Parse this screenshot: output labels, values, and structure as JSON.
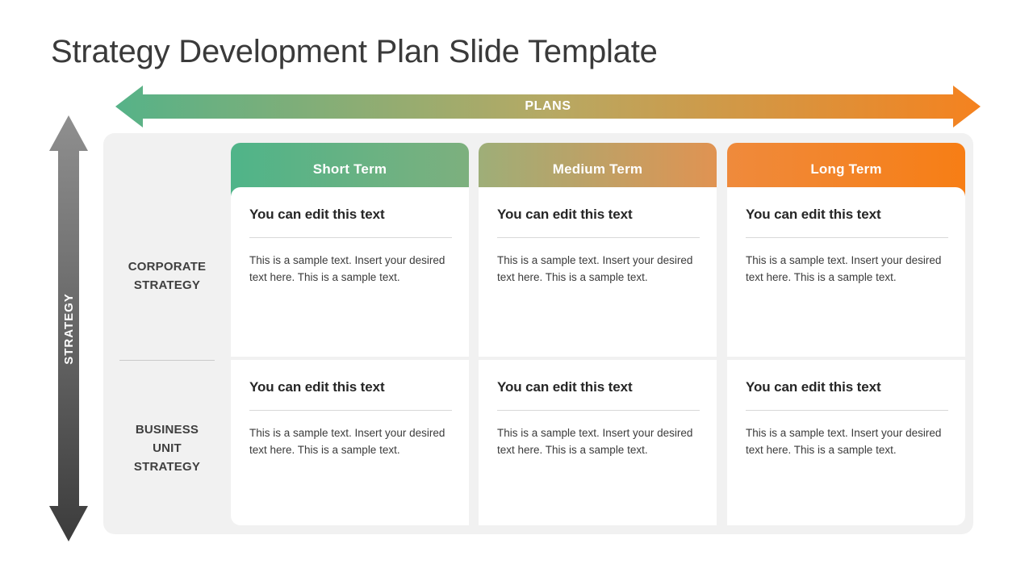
{
  "slide": {
    "title": "Strategy Development Plan Slide Template",
    "background_color": "#ffffff",
    "panel_color": "#f1f1f1"
  },
  "horizontal_axis": {
    "label": "PLANS",
    "icon": "double-headed-arrow-horizontal-icon",
    "gradient_start": "#56b288",
    "gradient_end": "#f5821f"
  },
  "vertical_axis": {
    "label": "STRATEGY",
    "icon": "double-headed-arrow-vertical-icon",
    "gradient_start": "#8a8a8a",
    "gradient_end": "#3c3c3c"
  },
  "columns": [
    {
      "label": "Short Term",
      "gradient_start": "#4fb489",
      "gradient_end": "#7db07e"
    },
    {
      "label": "Medium Term",
      "gradient_start": "#9eae78",
      "gradient_end": "#e09352"
    },
    {
      "label": "Long Term",
      "gradient_start": "#ef8a3c",
      "gradient_end": "#f77e15"
    }
  ],
  "rows": [
    {
      "label": "CORPORATE\nSTRATEGY"
    },
    {
      "label": "BUSINESS\nUNIT\nSTRATEGY"
    }
  ],
  "cells": [
    [
      {
        "heading": "You can edit this  text",
        "body": "This is a sample text.  Insert your desired text here. This is a sample text."
      },
      {
        "heading": "You can edit this  text",
        "body": "This is a sample text.  Insert your desired text here. This is a sample text."
      },
      {
        "heading": "You can edit this  text",
        "body": "This is a sample text.  Insert your desired text here. This is a sample text."
      }
    ],
    [
      {
        "heading": "You can edit this  text",
        "body": "This is a sample text.  Insert your desired text here. This is a sample text."
      },
      {
        "heading": "You can edit this  text",
        "body": "This is a sample text.  Insert your desired text here. This is a sample text."
      },
      {
        "heading": "You can edit this  text",
        "body": "This is a sample text.  Insert your desired text here. This is a sample text."
      }
    ]
  ]
}
